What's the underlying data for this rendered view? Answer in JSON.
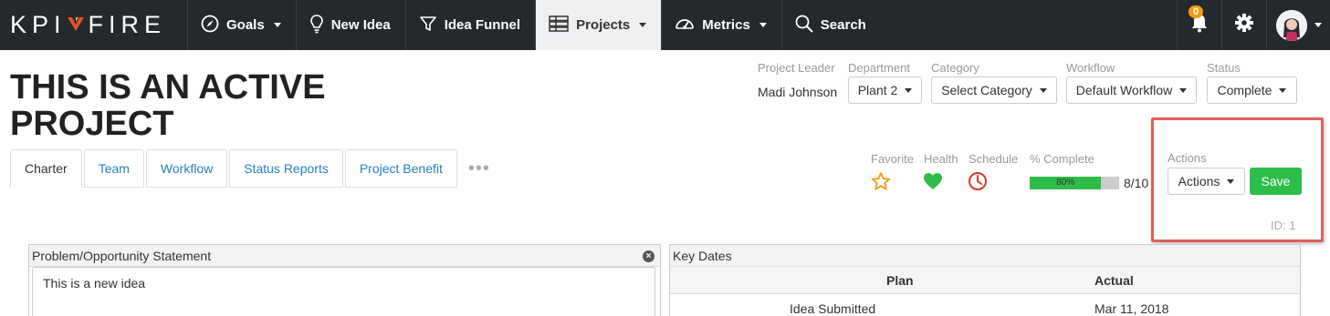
{
  "nav": {
    "logo_left": "KPI",
    "logo_right": "FIRE",
    "items": [
      {
        "label": "Goals",
        "icon": "compass-icon",
        "dropdown": true
      },
      {
        "label": "New Idea",
        "icon": "lightbulb-icon",
        "dropdown": false
      },
      {
        "label": "Idea Funnel",
        "icon": "funnel-icon",
        "dropdown": false
      },
      {
        "label": "Projects",
        "icon": "projects-icon",
        "dropdown": true,
        "active": true
      },
      {
        "label": "Metrics",
        "icon": "gauge-icon",
        "dropdown": true
      },
      {
        "label": "Search",
        "icon": "search-icon",
        "dropdown": false
      }
    ],
    "notification_count": "0"
  },
  "project": {
    "title": "THIS IS AN ACTIVE PROJECT",
    "leader_label": "Project Leader",
    "leader": "Madi Johnson",
    "department_label": "Department",
    "department": "Plant 2",
    "category_label": "Category",
    "category": "Select Category",
    "workflow_label": "Workflow",
    "workflow": "Default Workflow",
    "status_label": "Status",
    "status": "Complete",
    "id_text": "ID: 1"
  },
  "tabs": [
    {
      "label": "Charter",
      "active": true
    },
    {
      "label": "Team"
    },
    {
      "label": "Workflow"
    },
    {
      "label": "Status Reports"
    },
    {
      "label": "Project Benefit"
    }
  ],
  "tabs_more": "•••",
  "indicators": {
    "favorite_label": "Favorite",
    "health_label": "Health",
    "schedule_label": "Schedule",
    "complete_label": "% Complete",
    "complete_percent": 80,
    "complete_text": "80%",
    "tasks": "8/10"
  },
  "actions": {
    "label": "Actions",
    "dropdown_label": "Actions",
    "save_label": "Save"
  },
  "problem_panel": {
    "title": "Problem/Opportunity Statement",
    "text": "This is a new idea"
  },
  "key_dates": {
    "title": "Key Dates",
    "columns": [
      "Plan",
      "Actual"
    ],
    "rows": [
      {
        "name": "Idea Submitted",
        "actual": "Mar 11, 2018"
      }
    ]
  },
  "colors": {
    "nav_bg": "#24292d",
    "accent_green": "#2ebd4a",
    "link_blue": "#2a7fc1",
    "logo_red": "#e8502e",
    "highlight_red": "#e0605a",
    "badge_orange": "#f39c12"
  }
}
